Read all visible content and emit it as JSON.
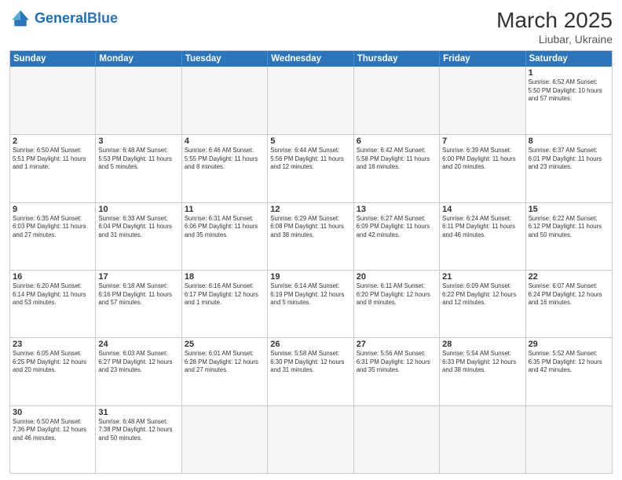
{
  "header": {
    "logo_general": "General",
    "logo_blue": "Blue",
    "month_title": "March 2025",
    "subtitle": "Liubar, Ukraine"
  },
  "days": [
    "Sunday",
    "Monday",
    "Tuesday",
    "Wednesday",
    "Thursday",
    "Friday",
    "Saturday"
  ],
  "weeks": [
    [
      {
        "day": "",
        "info": ""
      },
      {
        "day": "",
        "info": ""
      },
      {
        "day": "",
        "info": ""
      },
      {
        "day": "",
        "info": ""
      },
      {
        "day": "",
        "info": ""
      },
      {
        "day": "",
        "info": ""
      },
      {
        "day": "1",
        "info": "Sunrise: 6:52 AM\nSunset: 5:50 PM\nDaylight: 10 hours and 57 minutes."
      }
    ],
    [
      {
        "day": "2",
        "info": "Sunrise: 6:50 AM\nSunset: 5:51 PM\nDaylight: 11 hours and 1 minute."
      },
      {
        "day": "3",
        "info": "Sunrise: 6:48 AM\nSunset: 5:53 PM\nDaylight: 11 hours and 5 minutes."
      },
      {
        "day": "4",
        "info": "Sunrise: 6:46 AM\nSunset: 5:55 PM\nDaylight: 11 hours and 8 minutes."
      },
      {
        "day": "5",
        "info": "Sunrise: 6:44 AM\nSunset: 5:56 PM\nDaylight: 11 hours and 12 minutes."
      },
      {
        "day": "6",
        "info": "Sunrise: 6:42 AM\nSunset: 5:58 PM\nDaylight: 11 hours and 16 minutes."
      },
      {
        "day": "7",
        "info": "Sunrise: 6:39 AM\nSunset: 6:00 PM\nDaylight: 11 hours and 20 minutes."
      },
      {
        "day": "8",
        "info": "Sunrise: 6:37 AM\nSunset: 6:01 PM\nDaylight: 11 hours and 23 minutes."
      }
    ],
    [
      {
        "day": "9",
        "info": "Sunrise: 6:35 AM\nSunset: 6:03 PM\nDaylight: 11 hours and 27 minutes."
      },
      {
        "day": "10",
        "info": "Sunrise: 6:33 AM\nSunset: 6:04 PM\nDaylight: 11 hours and 31 minutes."
      },
      {
        "day": "11",
        "info": "Sunrise: 6:31 AM\nSunset: 6:06 PM\nDaylight: 11 hours and 35 minutes."
      },
      {
        "day": "12",
        "info": "Sunrise: 6:29 AM\nSunset: 6:08 PM\nDaylight: 11 hours and 38 minutes."
      },
      {
        "day": "13",
        "info": "Sunrise: 6:27 AM\nSunset: 6:09 PM\nDaylight: 11 hours and 42 minutes."
      },
      {
        "day": "14",
        "info": "Sunrise: 6:24 AM\nSunset: 6:11 PM\nDaylight: 11 hours and 46 minutes."
      },
      {
        "day": "15",
        "info": "Sunrise: 6:22 AM\nSunset: 6:12 PM\nDaylight: 11 hours and 50 minutes."
      }
    ],
    [
      {
        "day": "16",
        "info": "Sunrise: 6:20 AM\nSunset: 6:14 PM\nDaylight: 11 hours and 53 minutes."
      },
      {
        "day": "17",
        "info": "Sunrise: 6:18 AM\nSunset: 6:16 PM\nDaylight: 11 hours and 57 minutes."
      },
      {
        "day": "18",
        "info": "Sunrise: 6:16 AM\nSunset: 6:17 PM\nDaylight: 12 hours and 1 minute."
      },
      {
        "day": "19",
        "info": "Sunrise: 6:14 AM\nSunset: 6:19 PM\nDaylight: 12 hours and 5 minutes."
      },
      {
        "day": "20",
        "info": "Sunrise: 6:11 AM\nSunset: 6:20 PM\nDaylight: 12 hours and 8 minutes."
      },
      {
        "day": "21",
        "info": "Sunrise: 6:09 AM\nSunset: 6:22 PM\nDaylight: 12 hours and 12 minutes."
      },
      {
        "day": "22",
        "info": "Sunrise: 6:07 AM\nSunset: 6:24 PM\nDaylight: 12 hours and 16 minutes."
      }
    ],
    [
      {
        "day": "23",
        "info": "Sunrise: 6:05 AM\nSunset: 6:25 PM\nDaylight: 12 hours and 20 minutes."
      },
      {
        "day": "24",
        "info": "Sunrise: 6:03 AM\nSunset: 6:27 PM\nDaylight: 12 hours and 23 minutes."
      },
      {
        "day": "25",
        "info": "Sunrise: 6:01 AM\nSunset: 6:28 PM\nDaylight: 12 hours and 27 minutes."
      },
      {
        "day": "26",
        "info": "Sunrise: 5:58 AM\nSunset: 6:30 PM\nDaylight: 12 hours and 31 minutes."
      },
      {
        "day": "27",
        "info": "Sunrise: 5:56 AM\nSunset: 6:31 PM\nDaylight: 12 hours and 35 minutes."
      },
      {
        "day": "28",
        "info": "Sunrise: 5:54 AM\nSunset: 6:33 PM\nDaylight: 12 hours and 38 minutes."
      },
      {
        "day": "29",
        "info": "Sunrise: 5:52 AM\nSunset: 6:35 PM\nDaylight: 12 hours and 42 minutes."
      }
    ],
    [
      {
        "day": "30",
        "info": "Sunrise: 6:50 AM\nSunset: 7:36 PM\nDaylight: 12 hours and 46 minutes."
      },
      {
        "day": "31",
        "info": "Sunrise: 6:48 AM\nSunset: 7:38 PM\nDaylight: 12 hours and 50 minutes."
      },
      {
        "day": "",
        "info": ""
      },
      {
        "day": "",
        "info": ""
      },
      {
        "day": "",
        "info": ""
      },
      {
        "day": "",
        "info": ""
      },
      {
        "day": "",
        "info": ""
      }
    ]
  ]
}
